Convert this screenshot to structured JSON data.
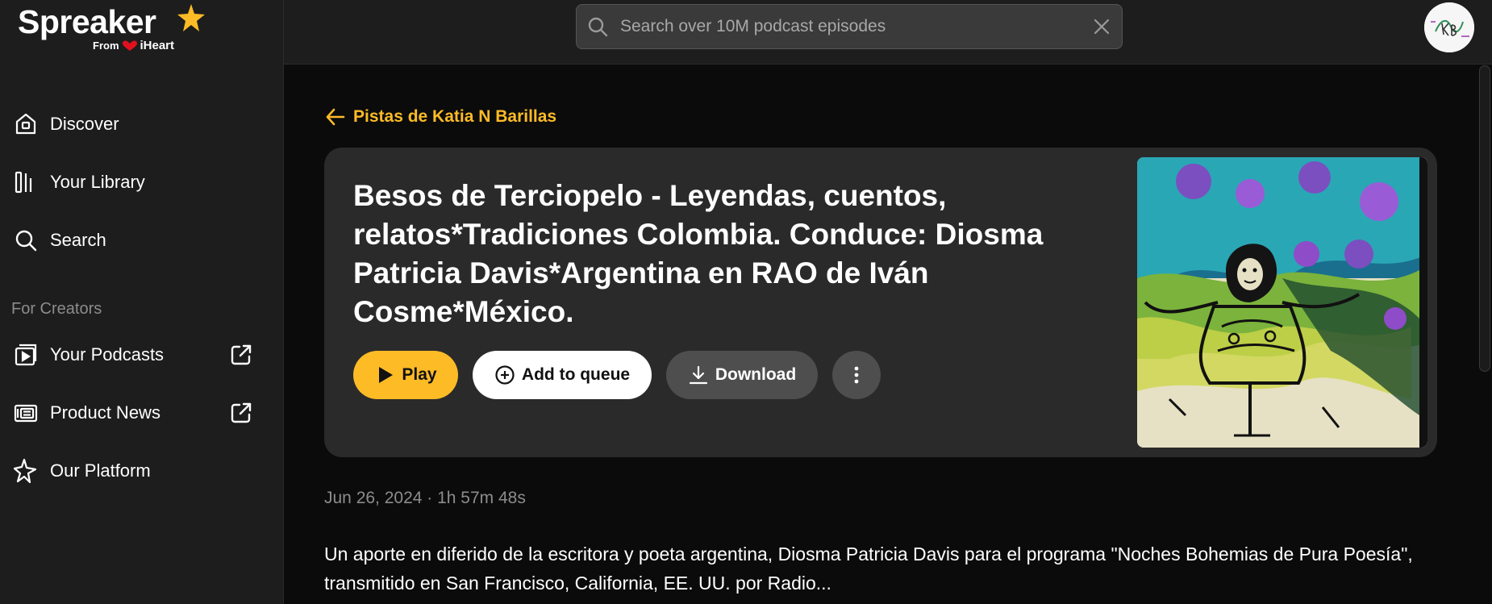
{
  "brand": {
    "name": "Spreaker",
    "from": "From",
    "partner": "iHeart",
    "accent": "#fdbb26"
  },
  "sidebar": {
    "items": [
      {
        "label": "Discover",
        "icon": "home-icon"
      },
      {
        "label": "Your Library",
        "icon": "library-icon"
      },
      {
        "label": "Search",
        "icon": "search-icon"
      }
    ],
    "creators_label": "For Creators",
    "creator_items": [
      {
        "label": "Your Podcasts",
        "icon": "podcast-icon",
        "external": true
      },
      {
        "label": "Product News",
        "icon": "news-icon",
        "external": true
      },
      {
        "label": "Our Platform",
        "icon": "sparkle-icon",
        "external": false
      }
    ]
  },
  "header": {
    "search_placeholder": "Search over 10M podcast episodes"
  },
  "main": {
    "back_label": "Pistas de Katia N Barillas",
    "episode_title": "Besos de Terciopelo - Leyendas, cuentos, relatos*Tradiciones Colombia. Conduce: Diosma Patricia Davis*Argentina en RAO de Iván Cosme*México.",
    "actions": {
      "play": "Play",
      "queue": "Add to queue",
      "download": "Download"
    },
    "meta": "Jun 26, 2024 · 1h 57m 48s",
    "description": "Un aporte en diferido de la escritora y poeta argentina, Diosma Patricia Davis para el programa \"Noches Bohemias de Pura Poesía\", transmitido en San Francisco, California, EE. UU. por Radio..."
  }
}
